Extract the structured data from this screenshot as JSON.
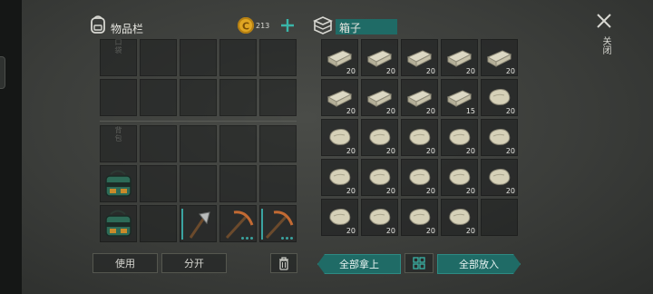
{
  "inventory": {
    "title": "物品栏",
    "currency": "213",
    "pocket_label": "口袋",
    "backpack_label": "背包"
  },
  "chest": {
    "title": "箱子",
    "stacks": [
      "20",
      "20",
      "20",
      "20",
      "20",
      "20",
      "20",
      "20",
      "15",
      "20",
      "20",
      "20",
      "20",
      "20",
      "20",
      "20",
      "20",
      "20",
      "20",
      "20",
      "20",
      "20",
      "20",
      "20"
    ],
    "stack_types": [
      "brick",
      "brick",
      "brick",
      "brick",
      "brick",
      "brick",
      "brick",
      "brick",
      "brick",
      "rock",
      "rock",
      "rock",
      "rock",
      "rock",
      "rock",
      "rock",
      "rock",
      "rock",
      "rock",
      "rock",
      "rock",
      "rock",
      "rock",
      "rock"
    ]
  },
  "buttons": {
    "use": "使用",
    "split": "分开",
    "take_all": "全部拿上",
    "put_all": "全部放入"
  },
  "close_label": "关闭",
  "colors": {
    "accent": "#1f6b66",
    "coin": "#e0a623",
    "plus": "#3ab5a8"
  }
}
